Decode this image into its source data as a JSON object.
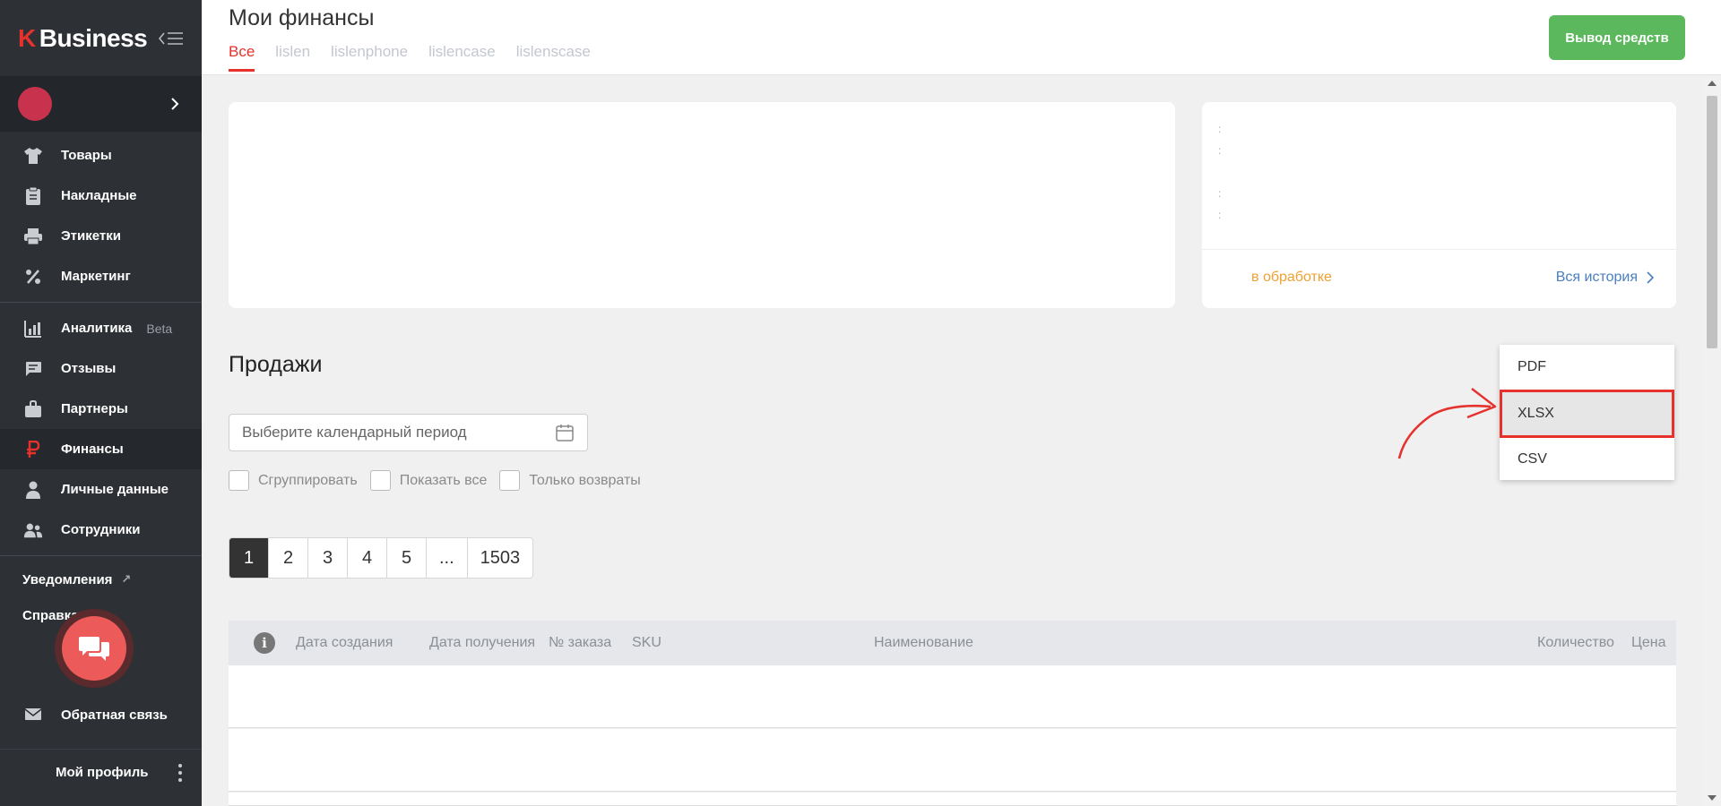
{
  "sidebar": {
    "logo_letter": "K",
    "logo_text": "Business",
    "nav": [
      {
        "label": "Товары",
        "icon": "shirt-icon"
      },
      {
        "label": "Накладные",
        "icon": "clipboard-icon"
      },
      {
        "label": "Этикетки",
        "icon": "printer-icon"
      },
      {
        "label": "Маркетинг",
        "icon": "percent-icon"
      },
      {
        "label": "Аналитика",
        "icon": "bar-chart-icon",
        "badge": "Beta"
      },
      {
        "label": "Отзывы",
        "icon": "comment-icon"
      },
      {
        "label": "Партнеры",
        "icon": "briefcase-icon"
      },
      {
        "label": "Финансы",
        "icon": "ruble-icon",
        "active": true
      },
      {
        "label": "Личные данные",
        "icon": "user-icon"
      },
      {
        "label": "Сотрудники",
        "icon": "users-icon"
      }
    ],
    "notifications_label": "Уведомления",
    "help_label": "Справка",
    "feedback_label": "Обратная связь",
    "profile_label": "Мой профиль"
  },
  "header": {
    "title": "Мои финансы",
    "tabs": [
      "Все",
      "lislen",
      "lislenphone",
      "lislencase",
      "lislenscase"
    ],
    "active_tab": "Все",
    "withdraw_label": "Вывод средств"
  },
  "summary": {
    "processing_label": "в обработке",
    "history_label": "Вся история"
  },
  "sales": {
    "title": "Продажи",
    "date_placeholder": "Выберите календарный период",
    "checkboxes": [
      "Сгруппировать",
      "Показать все",
      "Только возвраты"
    ],
    "pages": [
      "1",
      "2",
      "3",
      "4",
      "5",
      "...",
      "1503"
    ],
    "current_page": "1",
    "columns": [
      "Дата создания",
      "Дата получения",
      "№ заказа",
      "SKU",
      "Наименование",
      "Количество",
      "Цена"
    ]
  },
  "export_menu": {
    "options": [
      "PDF",
      "XLSX",
      "CSV"
    ],
    "highlighted": "XLSX"
  },
  "colors": {
    "accent": "#e5322d",
    "sidebar_bg": "#2d3035",
    "withdraw_button": "#5cb85c",
    "processing_text": "#f0a030",
    "history_link": "#4a7fc1"
  }
}
